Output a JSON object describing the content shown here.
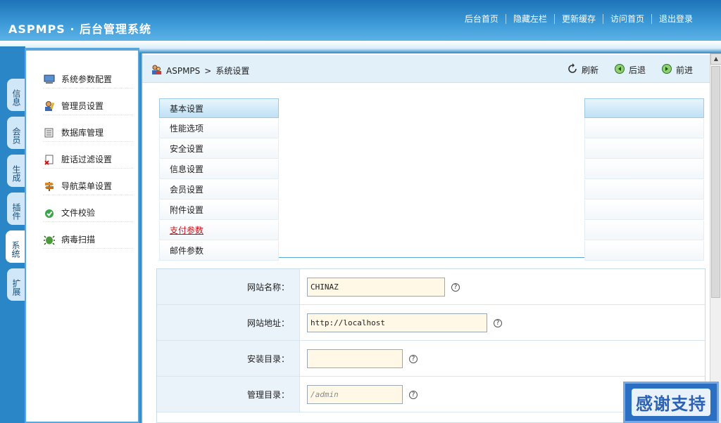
{
  "header": {
    "logo": "ASPMPS · 后台管理系统",
    "nav": [
      "后台首页",
      "隐藏左栏",
      "更新缓存",
      "访问首页",
      "退出登录"
    ]
  },
  "vtabs": [
    "信息",
    "会员",
    "生成",
    "插件",
    "系统",
    "扩展"
  ],
  "sidebar": {
    "items": [
      {
        "label": "系统参数配置",
        "icon": "monitor-icon"
      },
      {
        "label": "管理员设置",
        "icon": "admin-user-icon"
      },
      {
        "label": "数据库管理",
        "icon": "database-icon"
      },
      {
        "label": "脏话过滤设置",
        "icon": "filter-icon"
      },
      {
        "label": "导航菜单设置",
        "icon": "signpost-icon"
      },
      {
        "label": "文件校验",
        "icon": "check-shield-icon"
      },
      {
        "label": "病毒扫描",
        "icon": "bug-icon"
      }
    ]
  },
  "toolbar": {
    "breadcrumb_root": "ASPMPS",
    "breadcrumb_sep": ">",
    "breadcrumb_current": "系统设置",
    "refresh": "刷新",
    "back": "后退",
    "forward": "前进"
  },
  "categories": [
    "基本设置",
    "性能选项",
    "安全设置",
    "信息设置",
    "会员设置",
    "附件设置",
    "支付参数",
    "邮件参数"
  ],
  "form": {
    "rows": [
      {
        "label": "网站名称：",
        "value": "CHINAZ",
        "placeholder": ""
      },
      {
        "label": "网站地址：",
        "value": "http://localhost",
        "placeholder": ""
      },
      {
        "label": "安装目录：",
        "value": "",
        "placeholder": ""
      },
      {
        "label": "管理目录：",
        "value": "",
        "placeholder": "/admin"
      }
    ],
    "help": "?"
  },
  "badge": "感谢支持",
  "colors": {
    "accent": "#2a86c6",
    "active_tab": "#bfe0f5",
    "highlight": "#c0161e"
  }
}
